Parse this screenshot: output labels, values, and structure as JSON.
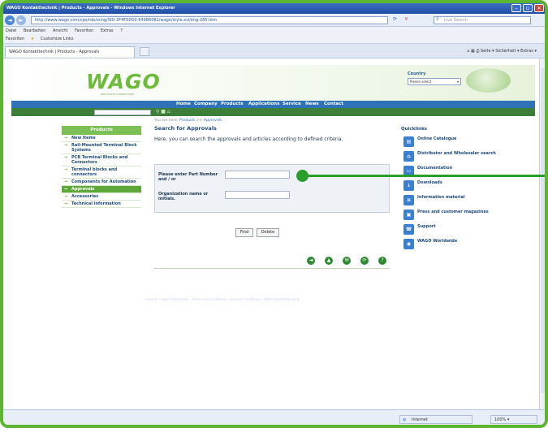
{
  "browser": {
    "title": "WAGO Kontakttechnik | Products - Approvals - Windows Internet Explorer",
    "url": "http://www.wago.com/cps/rde/xchg/SID-3F4F0D50-E4986082/wago/style.xsl/eng-285.htm",
    "search_placeholder": "Live Search",
    "menu": [
      "Datei",
      "Bearbeiten",
      "Ansicht",
      "Favoriten",
      "Extras",
      "?"
    ],
    "favorites_label": "Favoriten",
    "favorites_links": [
      "Customize Links"
    ],
    "tab_title": "WAGO Kontakttechnik | Products - Approvals",
    "toolbar_right": "Seite ▾  Sicherheit ▾  Extras ▾",
    "status_zone": "Internet",
    "status_zoom": "100%"
  },
  "wago": {
    "logo": "WAGO",
    "logo_sub": "INNOVATIVE CONNECTIONS",
    "country_label": "Country",
    "country_select": "Please select",
    "nav": [
      "Home",
      "Company",
      "Products",
      "Applications",
      "Service",
      "News",
      "Contact"
    ],
    "breadcrumb_prefix": "You are here:",
    "breadcrumb_links": [
      "Products",
      ">>",
      "Approvals"
    ]
  },
  "products_menu": {
    "heading": "Products",
    "items": [
      "New Items",
      "Rail-Mounted Terminal Block Systems",
      "PCB Terminal Blocks and Connectors",
      "Terminal blocks and connectors",
      "Components for Automation",
      "Approvals",
      "Accessories",
      "Technical information"
    ],
    "active_index": 5
  },
  "main": {
    "title": "Search for Approvals",
    "intro": "Here, you can search the approvals and articles according to defined criteria.",
    "part_label": "Please enter Part Number and / or",
    "org_label": "Organization name or initials.",
    "part_value": "",
    "org_value": "",
    "find_label": "Find",
    "delete_label": "Delete",
    "action_icons": [
      "◄",
      "▲",
      "✉",
      "⟳",
      "?"
    ],
    "footer_links": "Imprint  ·  Legal Information  ·  Terms and Conditions  ·  General Conditions  ·  WAGO Kontakttechnik"
  },
  "quicklinks": {
    "heading": "Quicklinks",
    "items": [
      {
        "label": "Online Catalogue",
        "icon": "catalogue-icon"
      },
      {
        "label": "Distributor and Wholesaler search",
        "icon": "distributor-icon"
      },
      {
        "label": "Documentation",
        "icon": "documentation-icon"
      },
      {
        "label": "Downloads",
        "icon": "downloads-icon"
      },
      {
        "label": "Information material",
        "icon": "information-icon"
      },
      {
        "label": "Press and customer magazines",
        "icon": "press-icon"
      },
      {
        "label": "Support",
        "icon": "support-icon"
      },
      {
        "label": "WAGO Worldwide",
        "icon": "worldwide-icon"
      }
    ]
  },
  "colors": {
    "frame_green": "#5cb531",
    "wago_green": "#6dbb3a",
    "nav_blue": "#2f72b8",
    "callout_green": "#2a9e2a"
  }
}
